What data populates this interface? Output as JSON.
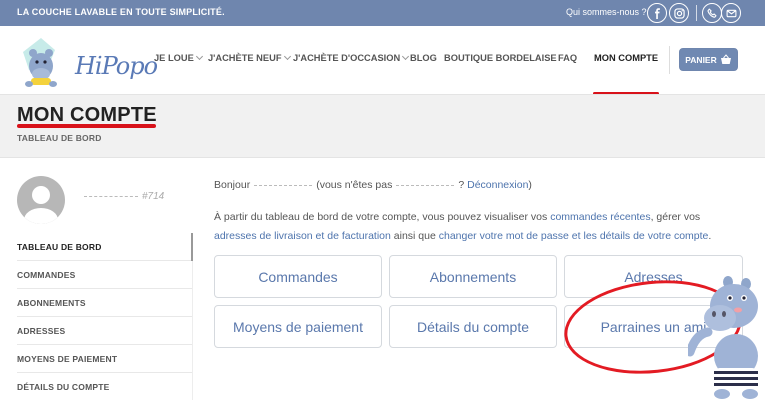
{
  "topbar": {
    "tagline": "LA COUCHE LAVABLE EN TOUTE SIMPLICITÉ.",
    "who_link": "Qui sommes-nous ?",
    "social_icons": [
      "facebook-icon",
      "instagram-icon",
      "phone-icon",
      "email-icon"
    ]
  },
  "header": {
    "logo_text": "HiPopo",
    "nav": [
      {
        "label": "JE LOUE",
        "dropdown": true
      },
      {
        "label": "J'ACHÈTE NEUF",
        "dropdown": true
      },
      {
        "label": "J'ACHÈTE D'OCCASION",
        "dropdown": true
      },
      {
        "label": "BLOG",
        "dropdown": false
      },
      {
        "label": "BOUTIQUE BORDELAISE",
        "dropdown": false
      },
      {
        "label": "FAQ",
        "dropdown": false
      },
      {
        "label": "MON COMPTE",
        "dropdown": false,
        "active": true
      }
    ],
    "cart_label": "PANIER"
  },
  "title": {
    "main": "MON COMPTE",
    "sub": "TABLEAU DE BORD"
  },
  "sidebar": {
    "user_id": "#714",
    "items": [
      {
        "label": "TABLEAU DE BORD",
        "active": true
      },
      {
        "label": "COMMANDES"
      },
      {
        "label": "ABONNEMENTS"
      },
      {
        "label": "ADRESSES"
      },
      {
        "label": "MOYENS DE PAIEMENT"
      },
      {
        "label": "DÉTAILS DU COMPTE"
      }
    ]
  },
  "main": {
    "hello_prefix": "Bonjour",
    "hello_mid": "(vous n'êtes pas",
    "hello_suffix": "?",
    "logout": "Déconnexion",
    "hello_close": ")",
    "intro": {
      "p1": "À partir du tableau de bord de votre compte, vous pouvez visualiser vos ",
      "l1": "commandes récentes",
      "p2": ", gérer vos ",
      "l2": "adresses de livraison et de facturation",
      "p3": " ainsi que ",
      "l3": "changer votre mot de passe et les détails de votre compte",
      "p4": "."
    },
    "tiles": [
      "Commandes",
      "Abonnements",
      "Adresses",
      "Moyens de paiement",
      "Détails du compte",
      "Parraines un ami"
    ]
  },
  "colors": {
    "topbar": "#6f86ae",
    "link": "#4e74ad",
    "annotation_red": "#e31b23"
  }
}
